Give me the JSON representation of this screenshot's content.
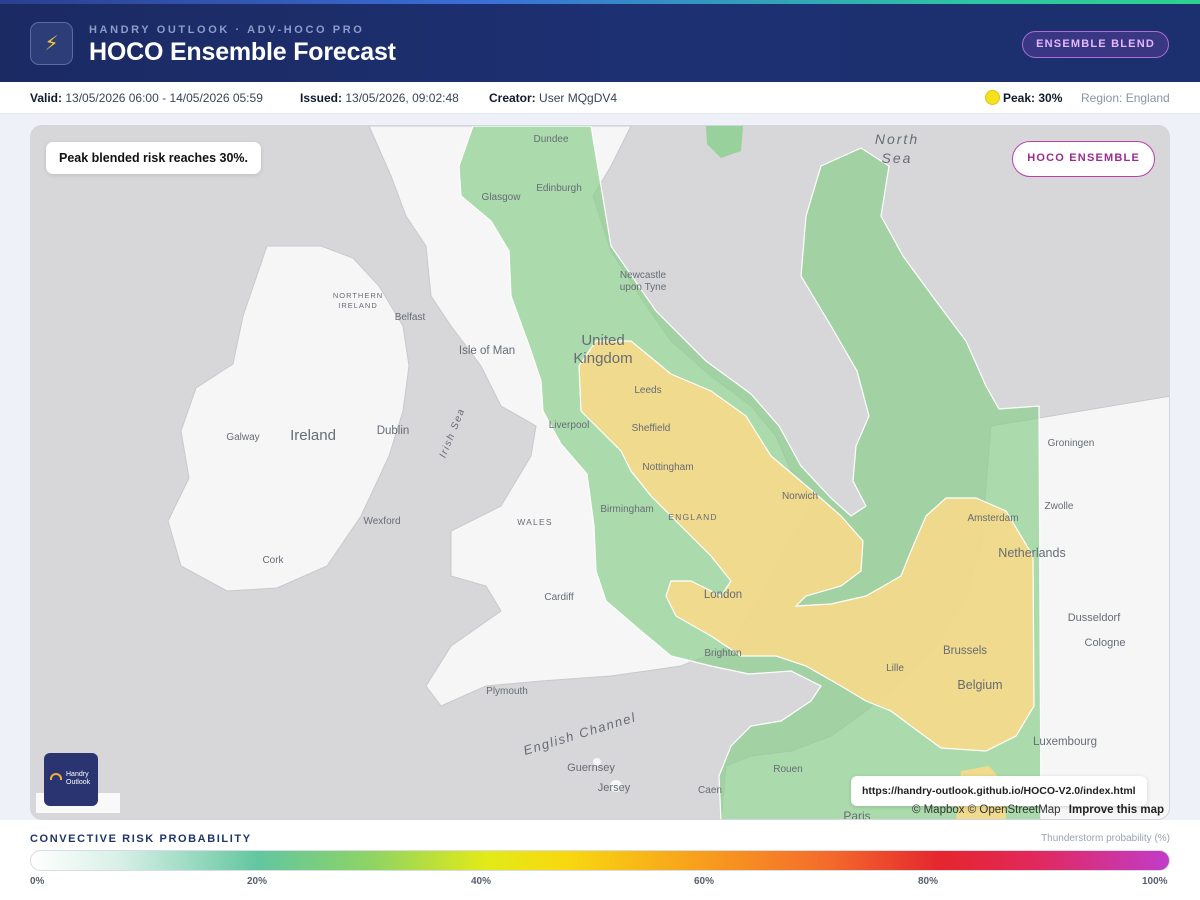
{
  "header": {
    "subtitle": "HANDRY OUTLOOK · ADV-HOCO PRO",
    "title": "HOCO Ensemble Forecast",
    "app_icon": "lightning-icon",
    "mode_badge": "ENSEMBLE BLEND"
  },
  "info": {
    "valid_label": "Valid:",
    "valid_value": "13/05/2026 06:00 - 14/05/2026 05:59",
    "issued_label": "Issued:",
    "issued_value": "13/05/2026, 09:02:48",
    "creator_label": "Creator:",
    "creator_value": "User MQgDV4",
    "peak_text": "Peak: 30%",
    "peak_color": "#f5e21c",
    "region_text": "Region: England"
  },
  "map": {
    "callout": "Peak blended risk reaches 30%.",
    "overlay_badge": "HOCO ENSEMBLE",
    "logo_text_1": "Handry",
    "logo_text_2": "Outlook",
    "url": "https://handry-outlook.github.io/HOCO-V2.0/index.html",
    "attribution": "© Mapbox © OpenStreetMap",
    "improve_link": "Improve this map",
    "risk_colors": {
      "low": "#8dd08f",
      "mid": "#f7d98a"
    },
    "places": {
      "dundee": "Dundee",
      "edinburgh": "Edinburgh",
      "glasgow": "Glasgow",
      "north": "North",
      "sea": "Sea",
      "newcastle1": "Newcastle",
      "newcastle2": "upon Tyne",
      "northern1": "NORTHERN",
      "northern2": "IRELAND",
      "belfast": "Belfast",
      "isle_of_man": "Isle of Man",
      "uk1": "United",
      "uk2": "Kingdom",
      "leeds": "Leeds",
      "ireland": "Ireland",
      "dublin": "Dublin",
      "irish_sea": "Irish Sea",
      "galway": "Galway",
      "liverpool": "Liverpool",
      "sheffield": "Sheffield",
      "nottingham": "Nottingham",
      "norwich": "Norwich",
      "groningen": "Groningen",
      "wales": "WALES",
      "birmingham": "Birmingham",
      "england": "ENGLAND",
      "amsterdam": "Amsterdam",
      "zwolle": "Zwolle",
      "netherlands": "Netherlands",
      "wexford": "Wexford",
      "cork": "Cork",
      "cardiff": "Cardiff",
      "london": "London",
      "dusseldorf": "Dusseldorf",
      "cologne": "Cologne",
      "brussels": "Brussels",
      "lille": "Lille",
      "belgium": "Belgium",
      "brighton": "Brighton",
      "plymouth": "Plymouth",
      "english_channel": "English Channel",
      "luxembourg": "Luxembourg",
      "guernsey": "Guernsey",
      "jersey": "Jersey",
      "rouen": "Rouen",
      "caen": "Caen",
      "paris": "Paris"
    }
  },
  "legend": {
    "title": "CONVECTIVE RISK PROBABILITY",
    "unit": "Thunderstorm probability (%)",
    "ticks": [
      "0%",
      "20%",
      "40%",
      "60%",
      "80%",
      "100%"
    ]
  }
}
